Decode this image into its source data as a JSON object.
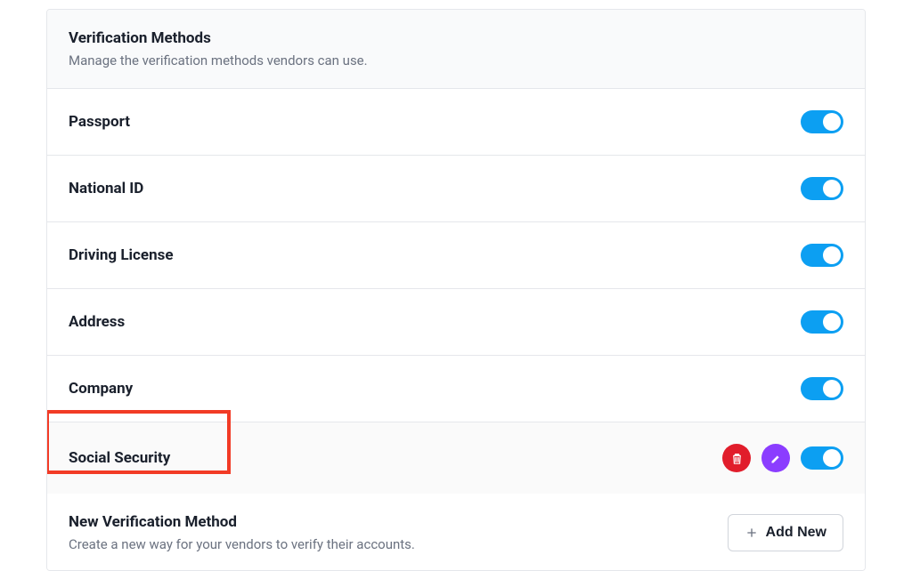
{
  "header": {
    "title": "Verification Methods",
    "subtitle": "Manage the verification methods vendors can use."
  },
  "methods": [
    {
      "name": "Passport",
      "enabled": true,
      "hasActions": false,
      "highlighted": false
    },
    {
      "name": "National ID",
      "enabled": true,
      "hasActions": false,
      "highlighted": false
    },
    {
      "name": "Driving License",
      "enabled": true,
      "hasActions": false,
      "highlighted": false
    },
    {
      "name": "Address",
      "enabled": true,
      "hasActions": false,
      "highlighted": false
    },
    {
      "name": "Company",
      "enabled": true,
      "hasActions": false,
      "highlighted": false
    },
    {
      "name": "Social Security",
      "enabled": true,
      "hasActions": true,
      "highlighted": true
    }
  ],
  "footer": {
    "title": "New Verification Method",
    "subtitle": "Create a new way for your vendors to verify their accounts.",
    "buttonLabel": "Add New"
  },
  "colors": {
    "toggleOn": "#0c9ff2",
    "delete": "#e11d2b",
    "edit": "#8b3dff",
    "highlightBorder": "#f23b26"
  }
}
